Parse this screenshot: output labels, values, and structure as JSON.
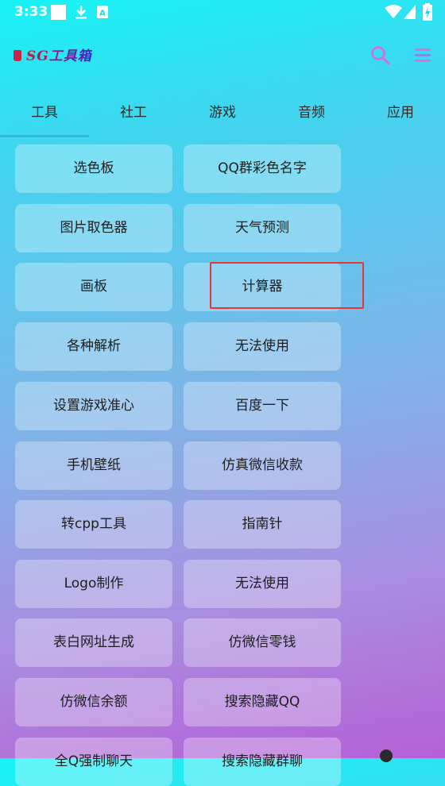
{
  "status_bar": {
    "time": "3:33"
  },
  "app": {
    "title": "SG工具箱"
  },
  "tabs": [
    {
      "label": "工具",
      "active": true
    },
    {
      "label": "社工"
    },
    {
      "label": "游戏"
    },
    {
      "label": "音频"
    },
    {
      "label": "应用"
    }
  ],
  "tools": {
    "left": [
      "选色板",
      "图片取色器",
      "画板",
      "各种解析",
      "设置游戏准心",
      "手机壁纸",
      "转cpp工具",
      "Logo制作",
      "表白网址生成",
      "仿微信余额",
      "全Q强制聊天"
    ],
    "right": [
      "QQ群彩色名字",
      "天气预测",
      "计算器",
      "无法使用",
      "百度一下",
      "仿真微信收款",
      "指南针",
      "无法使用",
      "仿微信零钱",
      "搜索隐藏QQ",
      "搜索隐藏群聊"
    ]
  },
  "highlighted_item": "计算器",
  "colors": {
    "accent": "#2fb8d2",
    "highlight_border": "#e53935"
  }
}
